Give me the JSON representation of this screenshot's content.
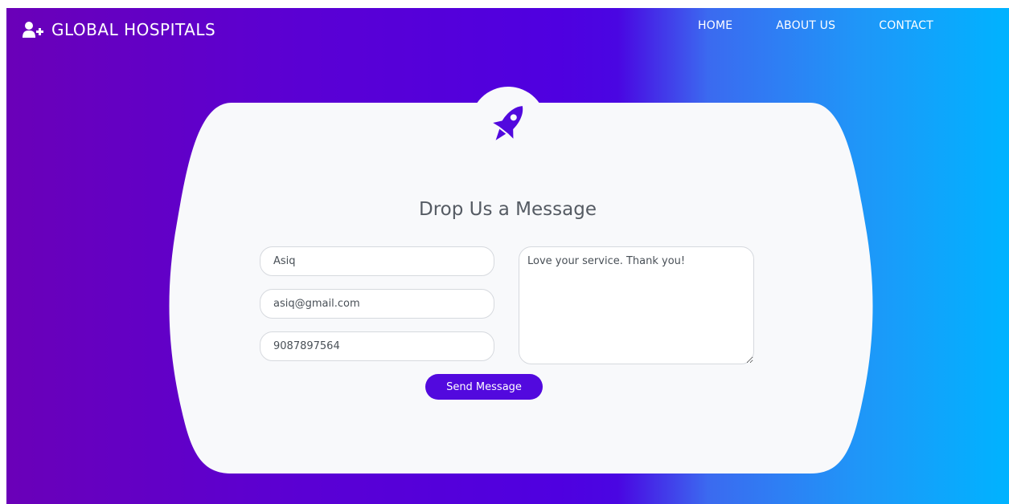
{
  "brand": {
    "name": "GLOBAL HOSPITALS",
    "icon": "user-plus-icon"
  },
  "nav": {
    "items": [
      "HOME",
      "ABOUT US",
      "CONTACT"
    ]
  },
  "form": {
    "badge_icon": "rocket-icon",
    "title": "Drop Us a Message",
    "name_value": "Asiq",
    "email_value": "asiq@gmail.com",
    "phone_value": "9087897564",
    "message_value": "Love your service. Thank you!",
    "submit_label": "Send Message"
  },
  "colors": {
    "gradient_start": "#6a00b8",
    "gradient_mid": "#4f00e0",
    "gradient_end": "#00b3ff",
    "card_bg": "#f8f9fb",
    "button_bg": "#5209de"
  }
}
